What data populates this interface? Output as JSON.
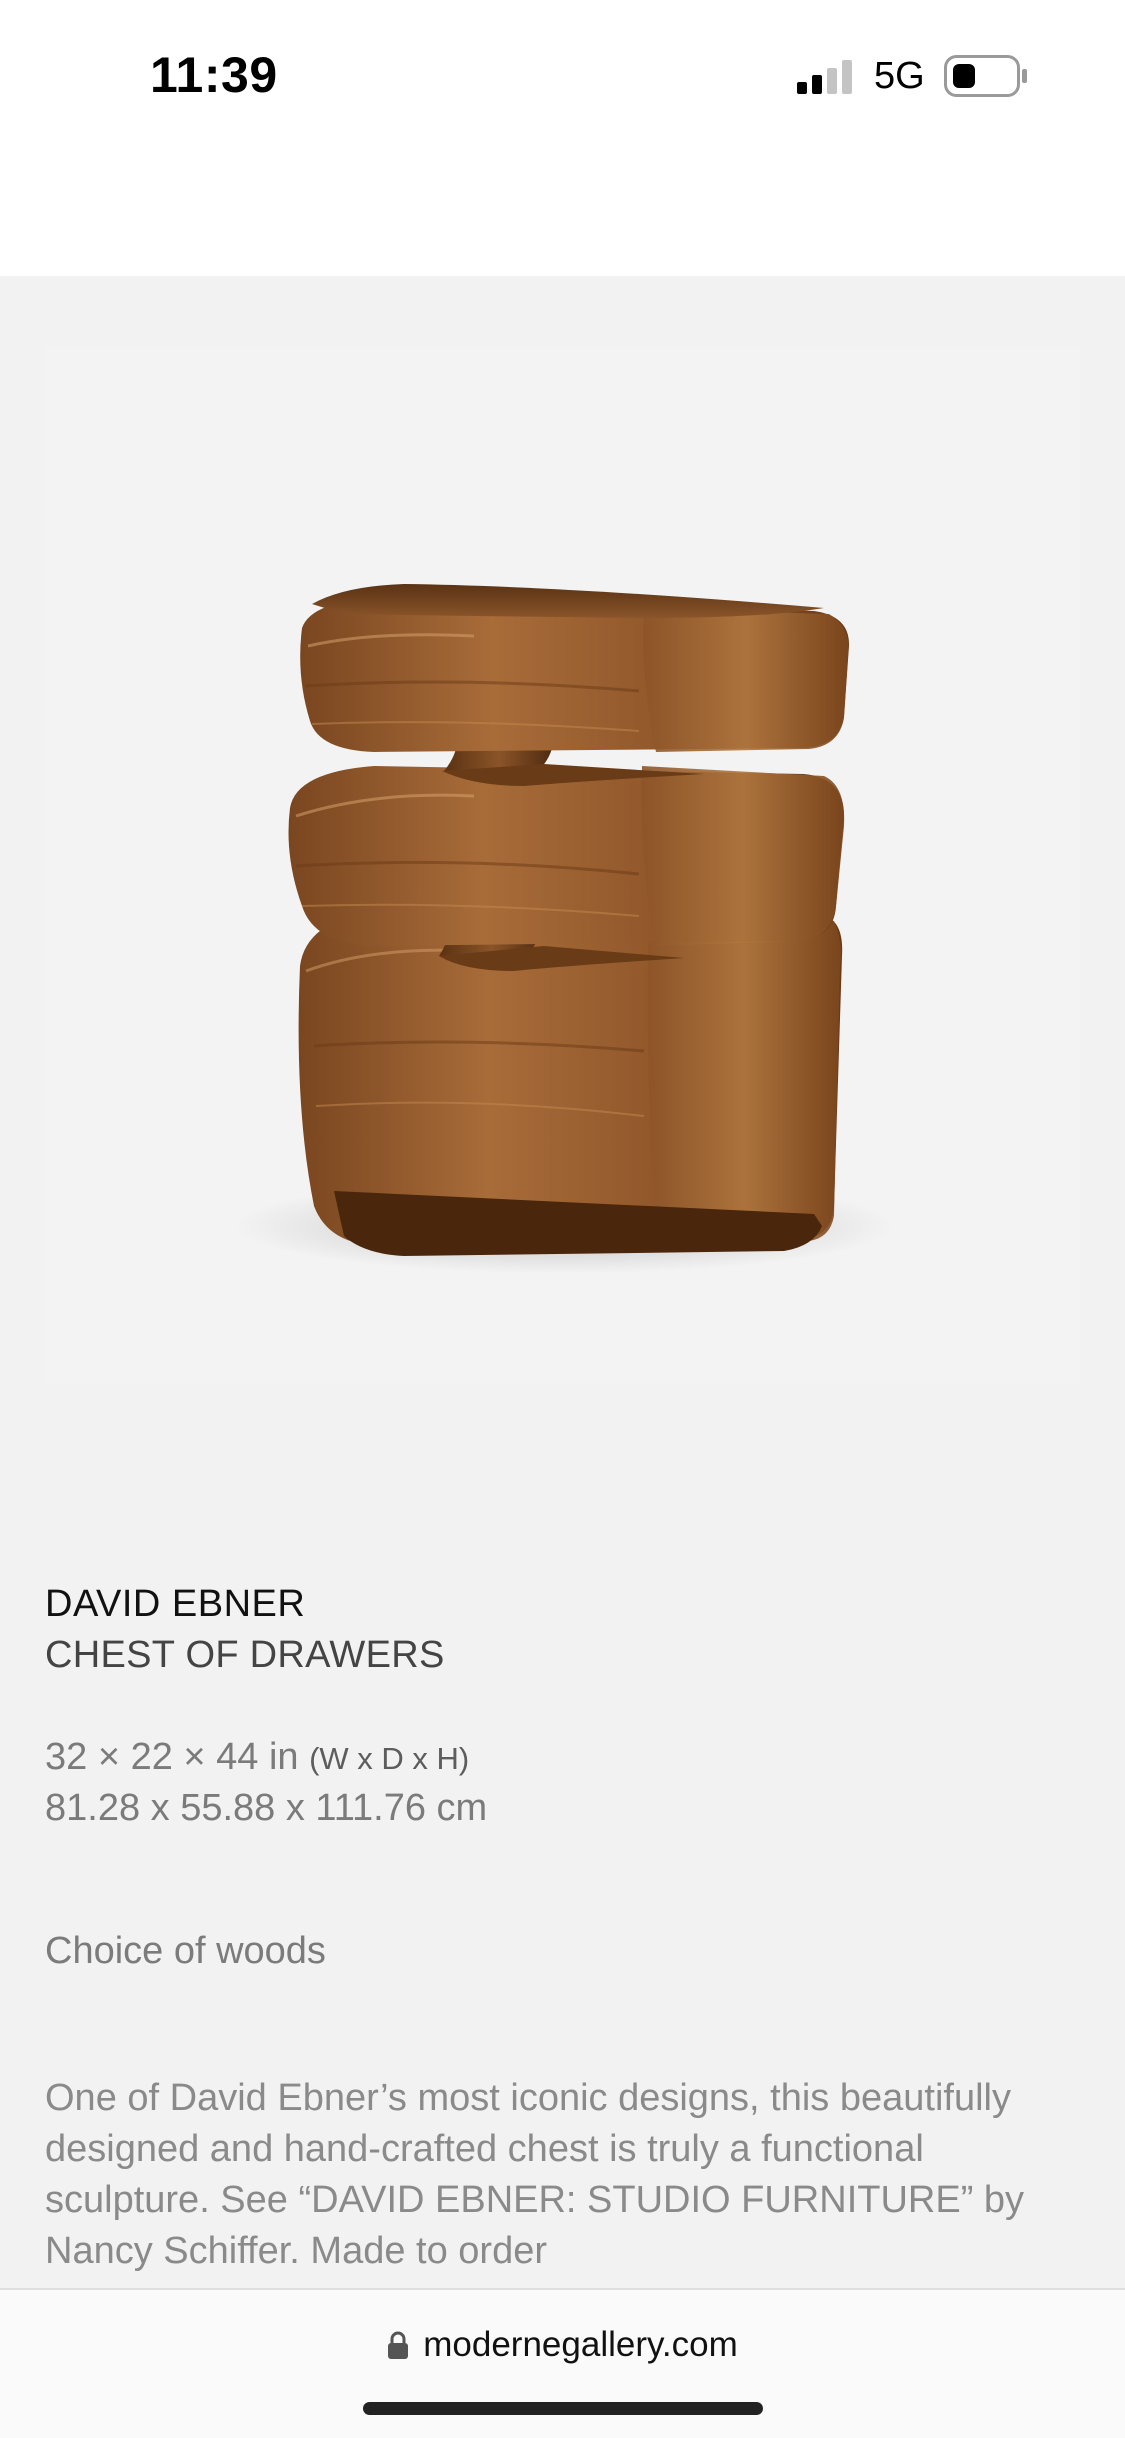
{
  "status_bar": {
    "time": "11:39",
    "network": "5G",
    "signal_bars_active": 2,
    "signal_bars_total": 4,
    "battery_icon": "battery-low-icon"
  },
  "product": {
    "image": "chest-of-drawers-image",
    "designer": "DAVID EBNER",
    "title": "CHEST OF DRAWERS",
    "dimensions_in": "32 × 22 × 44 in ",
    "dimensions_in_suffix": "(W x D x H)",
    "dimensions_cm": "81.28 x 55.88 x 111.76 cm",
    "woods": "Choice of woods",
    "description": "One of David Ebner’s most iconic designs, this beautifully designed and hand-crafted chest is truly a functional sculpture. See “DAVID EBNER: STUDIO FURNITURE” by Nancy Schiffer. Made to order"
  },
  "browser": {
    "url": "modernegallery.com",
    "lock_icon": "lock-icon"
  },
  "colors": {
    "page_background": "#f2f2f2",
    "wood_dark": "#6b3b17",
    "wood_mid": "#9a6233",
    "wood_light": "#c58a52"
  }
}
